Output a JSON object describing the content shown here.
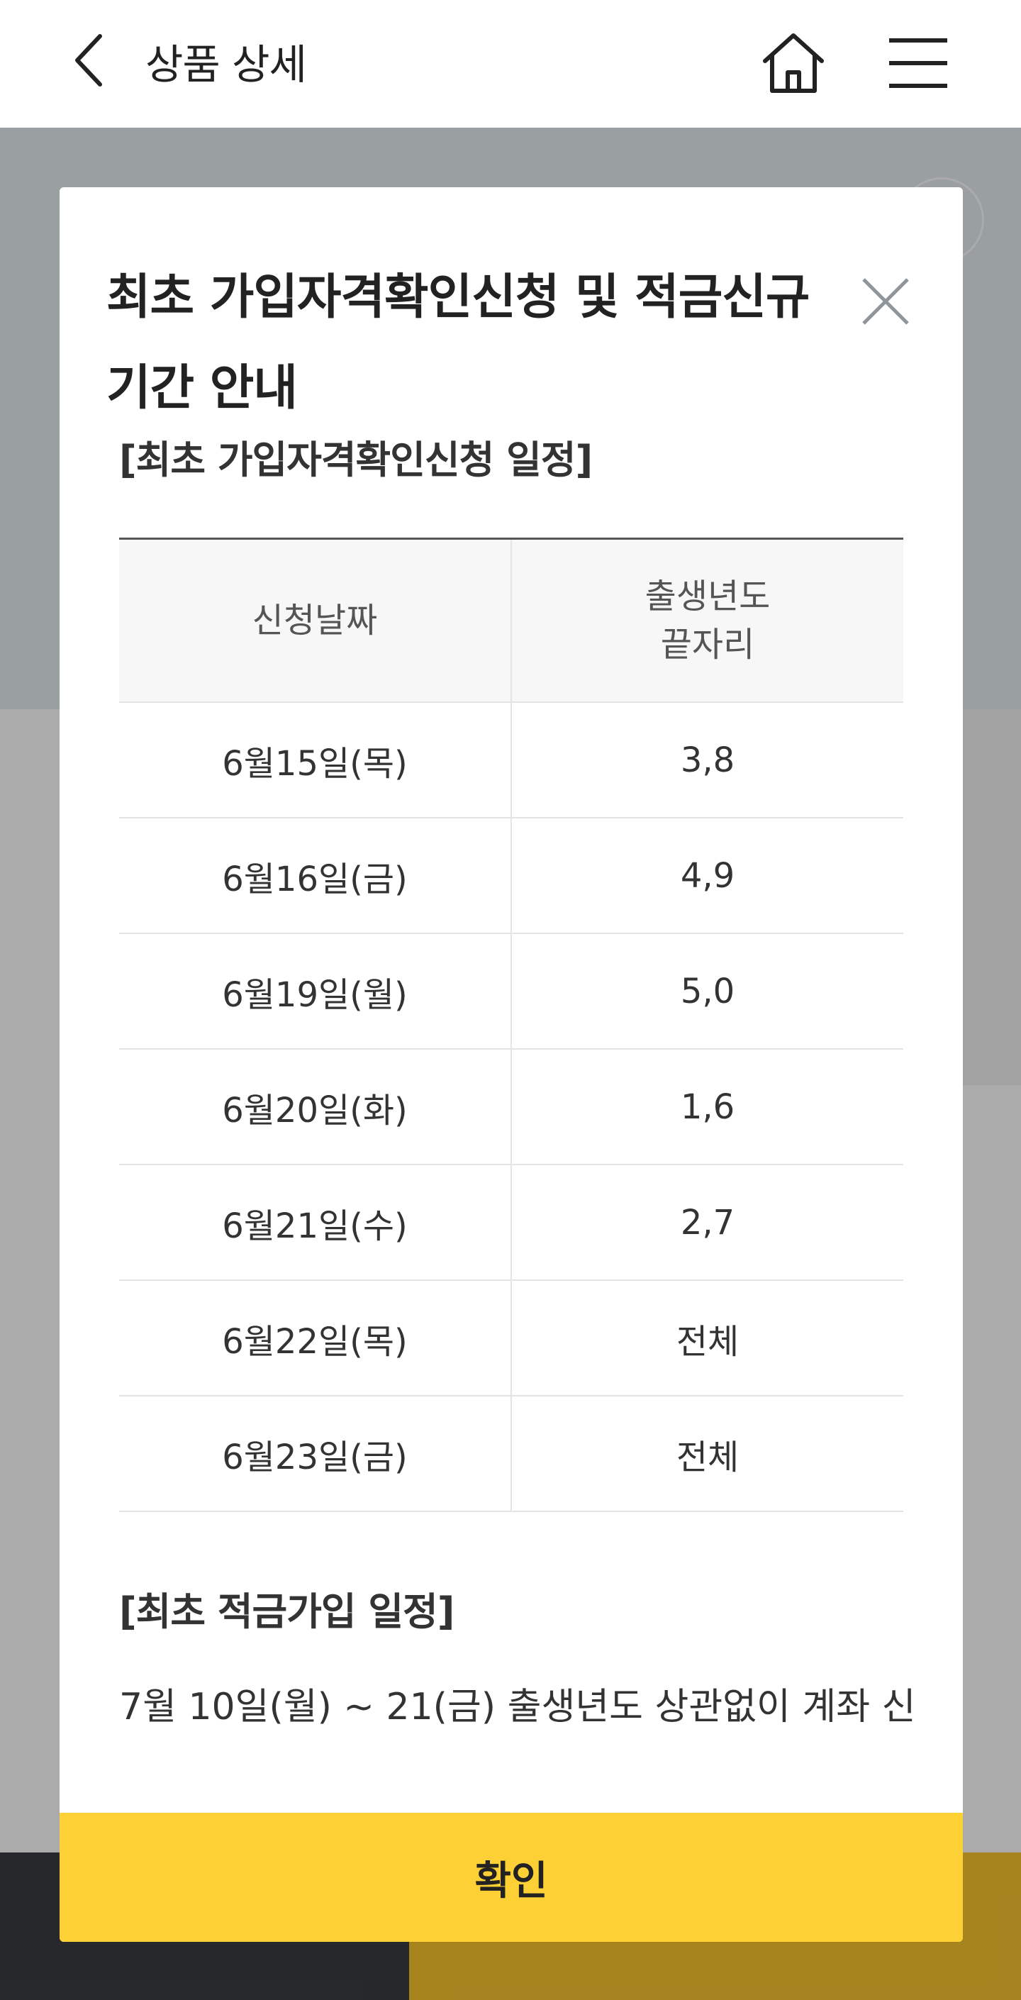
{
  "header": {
    "title": "상품 상세",
    "back_icon": "chevron-left-icon",
    "home_icon": "home-icon",
    "menu_icon": "hamburger-menu-icon"
  },
  "modal": {
    "title": "최초 가입자격확인신청 및 적금신규 기간 안내",
    "close_icon": "close-icon",
    "section1_heading": "[최초 가입자격확인신청 일정]",
    "table": {
      "headers": [
        "신청날짜",
        "출생년도\n끝자리"
      ],
      "header_col2_line1": "출생년도",
      "header_col2_line2": "끝자리",
      "rows": [
        {
          "date": "6월15일(목)",
          "digits": "3,8"
        },
        {
          "date": "6월16일(금)",
          "digits": "4,9"
        },
        {
          "date": "6월19일(월)",
          "digits": "5,0"
        },
        {
          "date": "6월20일(화)",
          "digits": "1,6"
        },
        {
          "date": "6월21일(수)",
          "digits": "2,7"
        },
        {
          "date": "6월22일(목)",
          "digits": "전체"
        },
        {
          "date": "6월23일(금)",
          "digits": "전체"
        }
      ]
    },
    "section2_heading": "[최초 적금가입 일정]",
    "section2_text": "7월 10일(월) ~ 21(금) 출생년도 상관없이 계좌 신",
    "confirm_label": "확인"
  },
  "colors": {
    "accent_yellow": "#fdd035",
    "bottom_bar_dark": "#3a3d42",
    "bottom_bar_yellow": "#f9c52e"
  }
}
